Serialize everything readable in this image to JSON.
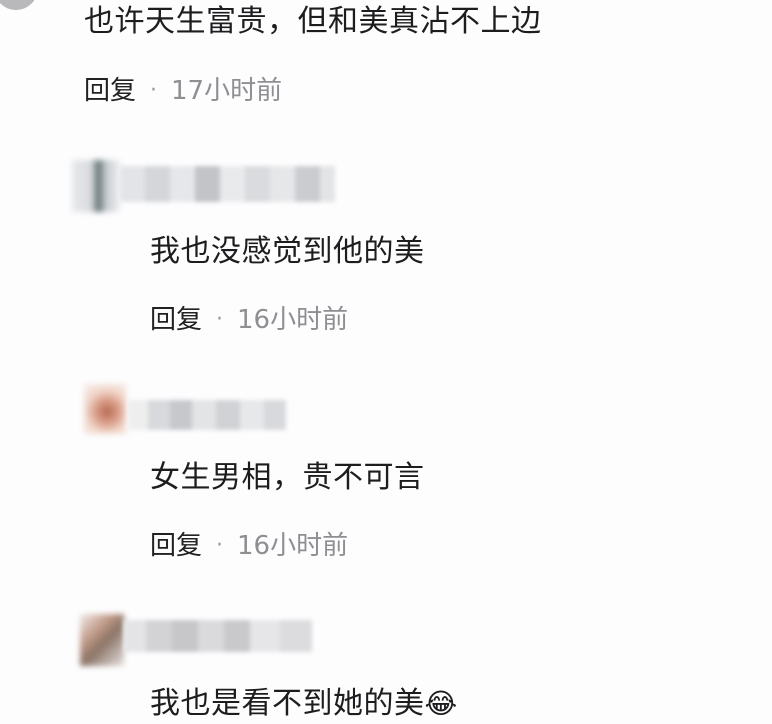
{
  "comments": [
    {
      "text": "也许天生富贵，但和美真沾不上边",
      "reply_label": "回复",
      "separator": "·",
      "time": "17小时前"
    },
    {
      "text": "我也没感觉到他的美",
      "reply_label": "回复",
      "separator": "·",
      "time": "16小时前"
    },
    {
      "text": "女生男相，贵不可言",
      "reply_label": "回复",
      "separator": "·",
      "time": "16小时前"
    },
    {
      "text": "我也是看不到她的美",
      "emoji": "😂"
    }
  ]
}
